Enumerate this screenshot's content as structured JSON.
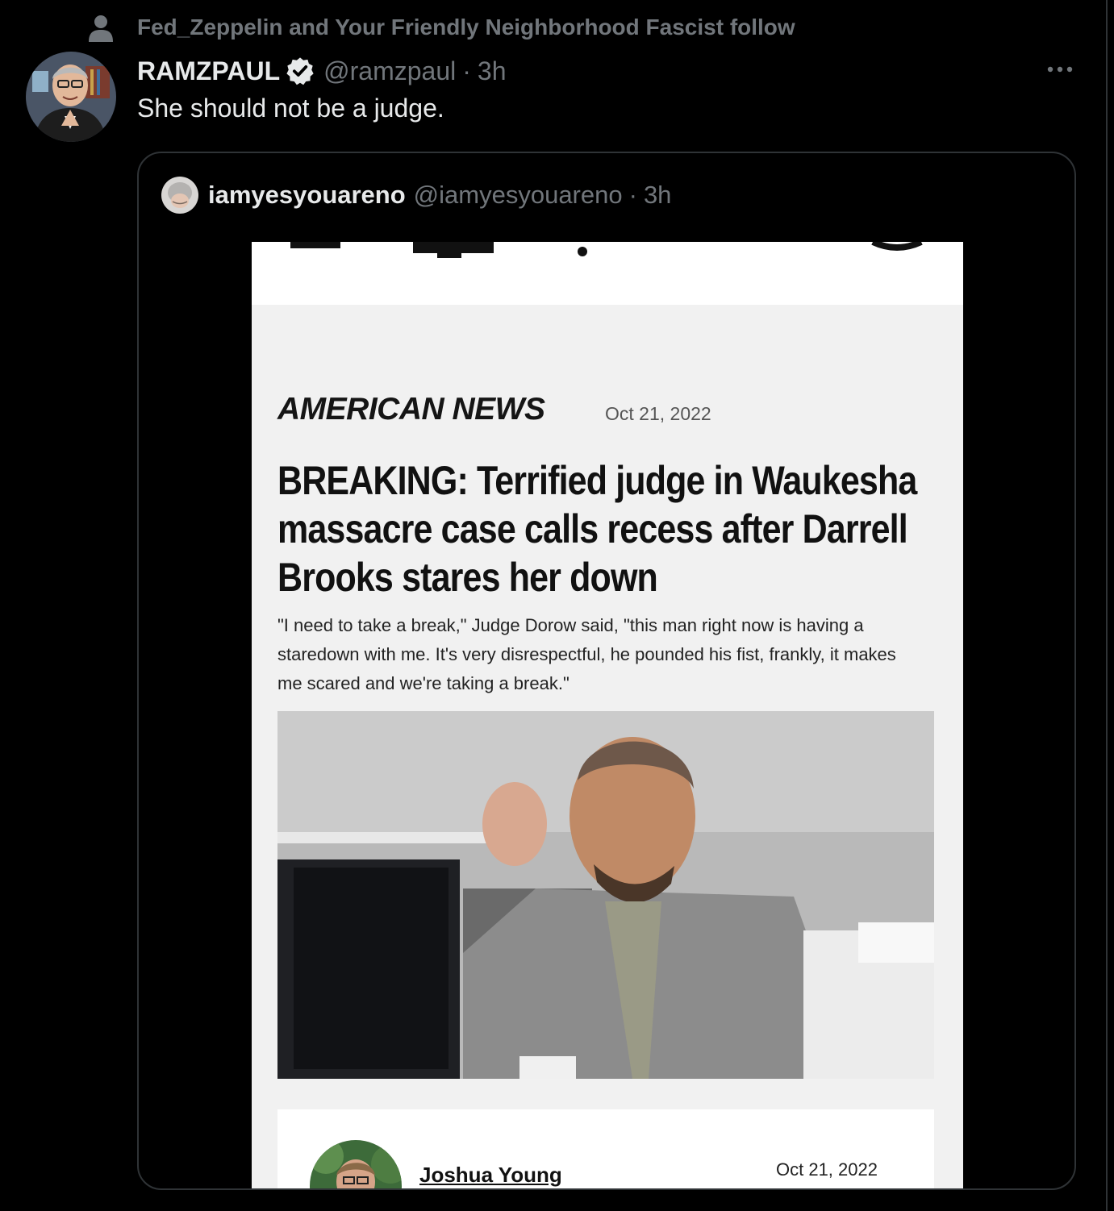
{
  "social_context": {
    "text": "Fed_Zeppelin and Your Friendly Neighborhood Fascist follow",
    "icon": "person-icon"
  },
  "tweet": {
    "display_name": "RAMZPAUL",
    "handle": "@ramzpaul",
    "separator": "·",
    "time": "3h",
    "text": "She should not be a judge.",
    "verified_icon": "verified-badge-icon",
    "more_icon": "more-options-icon"
  },
  "quote": {
    "display_name": "iamyesyouareno",
    "handle": "@iamyesyouareno",
    "separator": "·",
    "time": "3h"
  },
  "article": {
    "section": "AMERICAN NEWS",
    "date": "Oct 21, 2022",
    "headline": "BREAKING: Terrified judge in Waukesha massacre case calls recess after Darrell Brooks stares her down",
    "standfirst": "\"I need to take a break,\" Judge Dorow said, \"this man right now is having a staredown with me. It's very disrespectful, he pounded his fist, frankly, it makes me scared and we're taking a break.\"",
    "author": "Joshua Young",
    "byline_date": "Oct 21, 2022"
  },
  "colors": {
    "background": "#000000",
    "text_primary": "#e7e9ea",
    "text_secondary": "#71767b",
    "border": "#2f3336",
    "article_bg": "#f1f1f1"
  }
}
